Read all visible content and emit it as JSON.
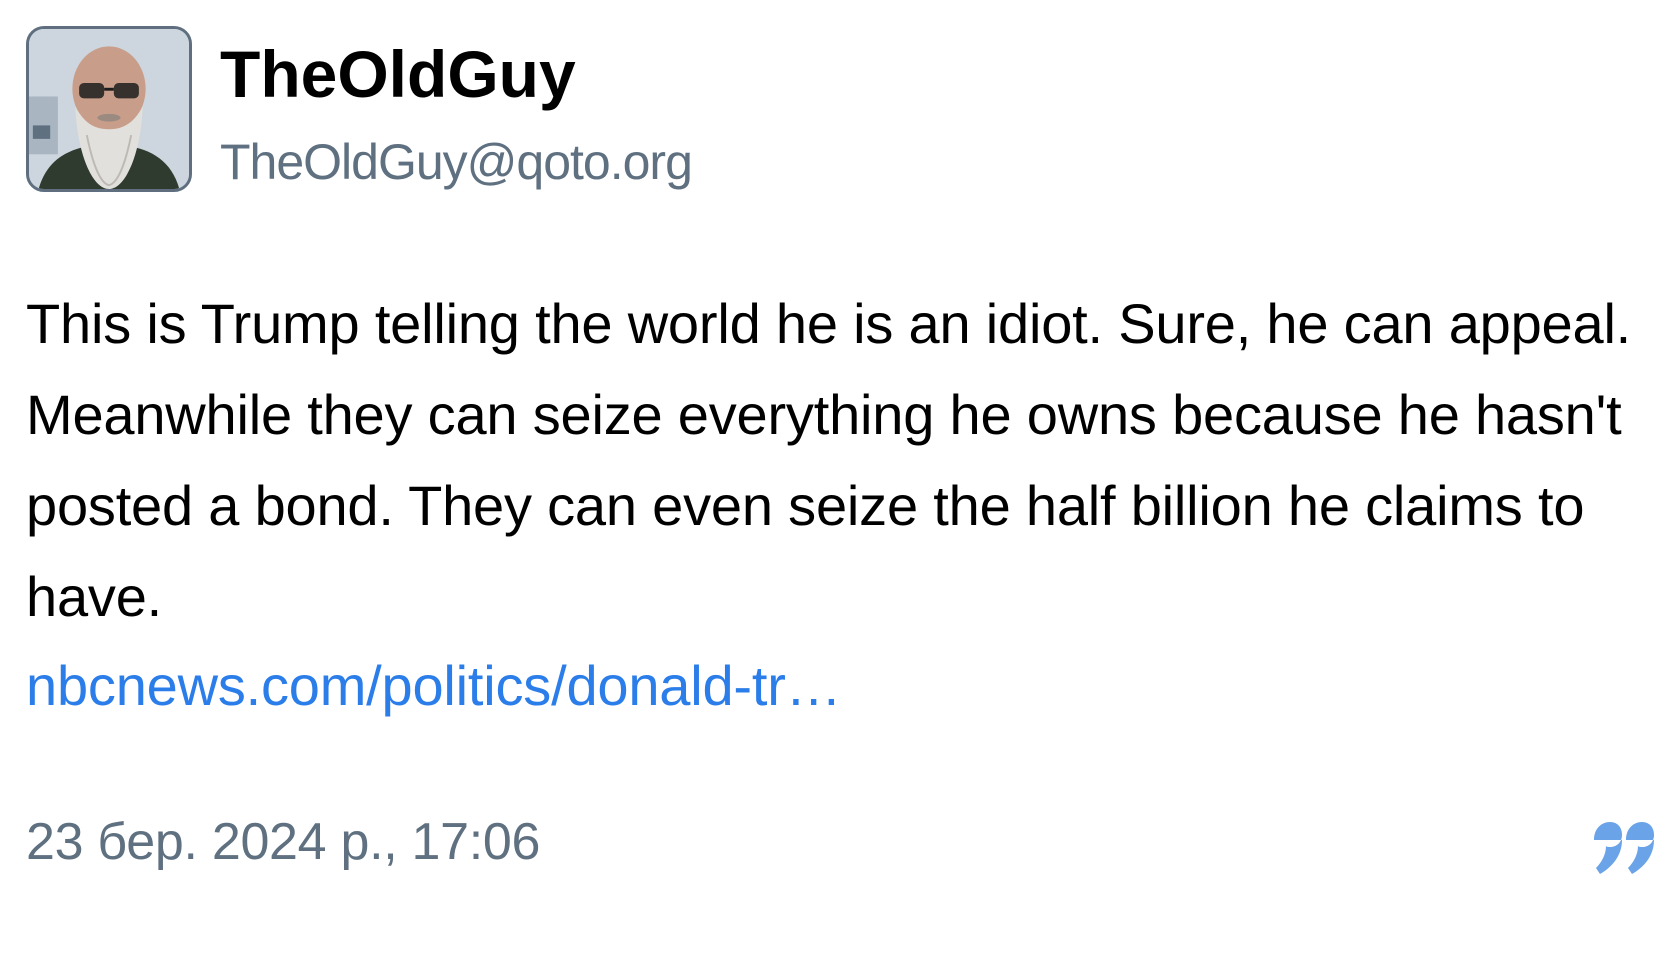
{
  "author": {
    "display_name": "TheOldGuy",
    "handle": "TheOldGuy@qoto.org",
    "avatar_icon": "avatar-photo"
  },
  "post": {
    "text": "This is Trump telling the world he is an idiot. Sure, he can appeal. Meanwhile they can seize everything he owns because he hasn't posted a bond. They can even seize the half billion he claims to have.",
    "link_text": "nbcnews.com/politics/donald-tr…",
    "timestamp": "23 бер. 2024 р., 17:06"
  },
  "icons": {
    "quote": "quote-icon"
  },
  "colors": {
    "link": "#2b7de9",
    "muted_text": "#5f7080",
    "quote_icon": "#6aa3e8"
  }
}
